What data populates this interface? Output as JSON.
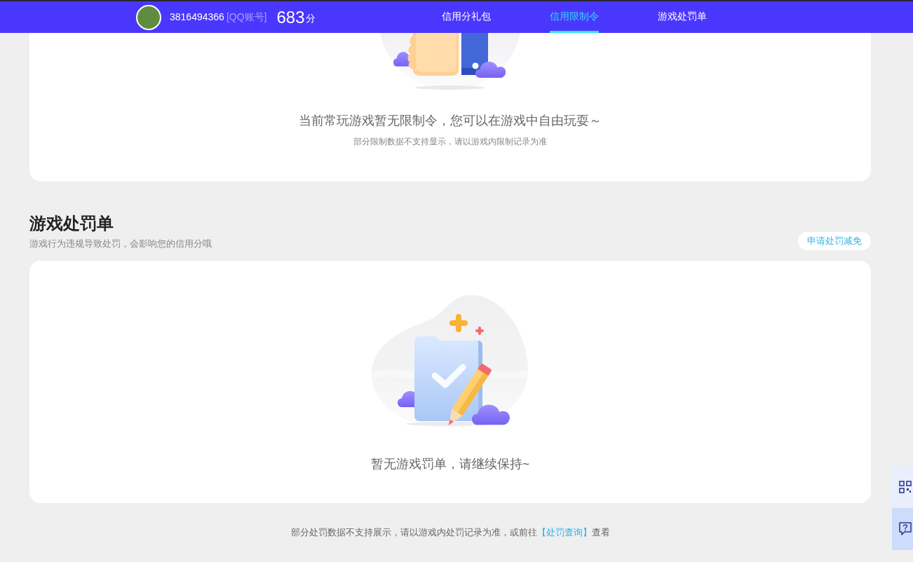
{
  "header": {
    "account_id": "3816494366",
    "account_type": "[QQ账号]",
    "score": "683",
    "score_unit": "分"
  },
  "nav_tabs": [
    {
      "label": "信用分礼包",
      "selected": false
    },
    {
      "label": "信用限制令",
      "selected": true
    },
    {
      "label": "游戏处罚单",
      "selected": false
    }
  ],
  "restriction_card": {
    "message": "当前常玩游戏暂无限制令，您可以在游戏中自由玩耍～",
    "note": "部分限制数据不支持显示，请以游戏内限制记录为准"
  },
  "penalty_section": {
    "title": "游戏处罚单",
    "subtitle": "游戏行为违规导致处罚，会影响您的信用分哦",
    "appeal_button": "申请处罚减免",
    "empty_message": "暂无游戏罚单，请继续保持~"
  },
  "footer_note": {
    "text_before": "部分处罚数据不支持展示，请以游戏内处罚记录为准，或前往",
    "link": "【处罚查询】",
    "text_after": "查看"
  }
}
